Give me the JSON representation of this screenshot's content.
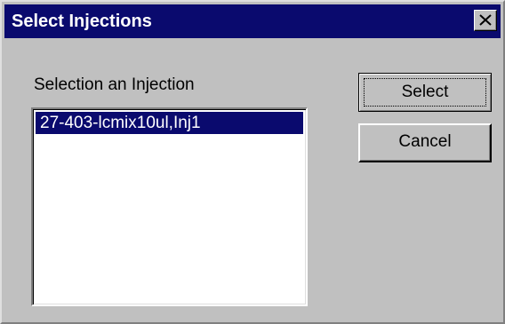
{
  "window": {
    "title": "Select Injections",
    "close_icon": "close-icon"
  },
  "selection": {
    "label": "Selection an Injection",
    "items": [
      {
        "label": "27-403-lcmix10ul,Inj1",
        "selected": true
      }
    ]
  },
  "buttons": {
    "select_label": "Select",
    "cancel_label": "Cancel"
  },
  "colors": {
    "titlebar": "#0a0a6e",
    "face": "#c0c0c0",
    "selection_highlight": "#0a0a6e"
  }
}
